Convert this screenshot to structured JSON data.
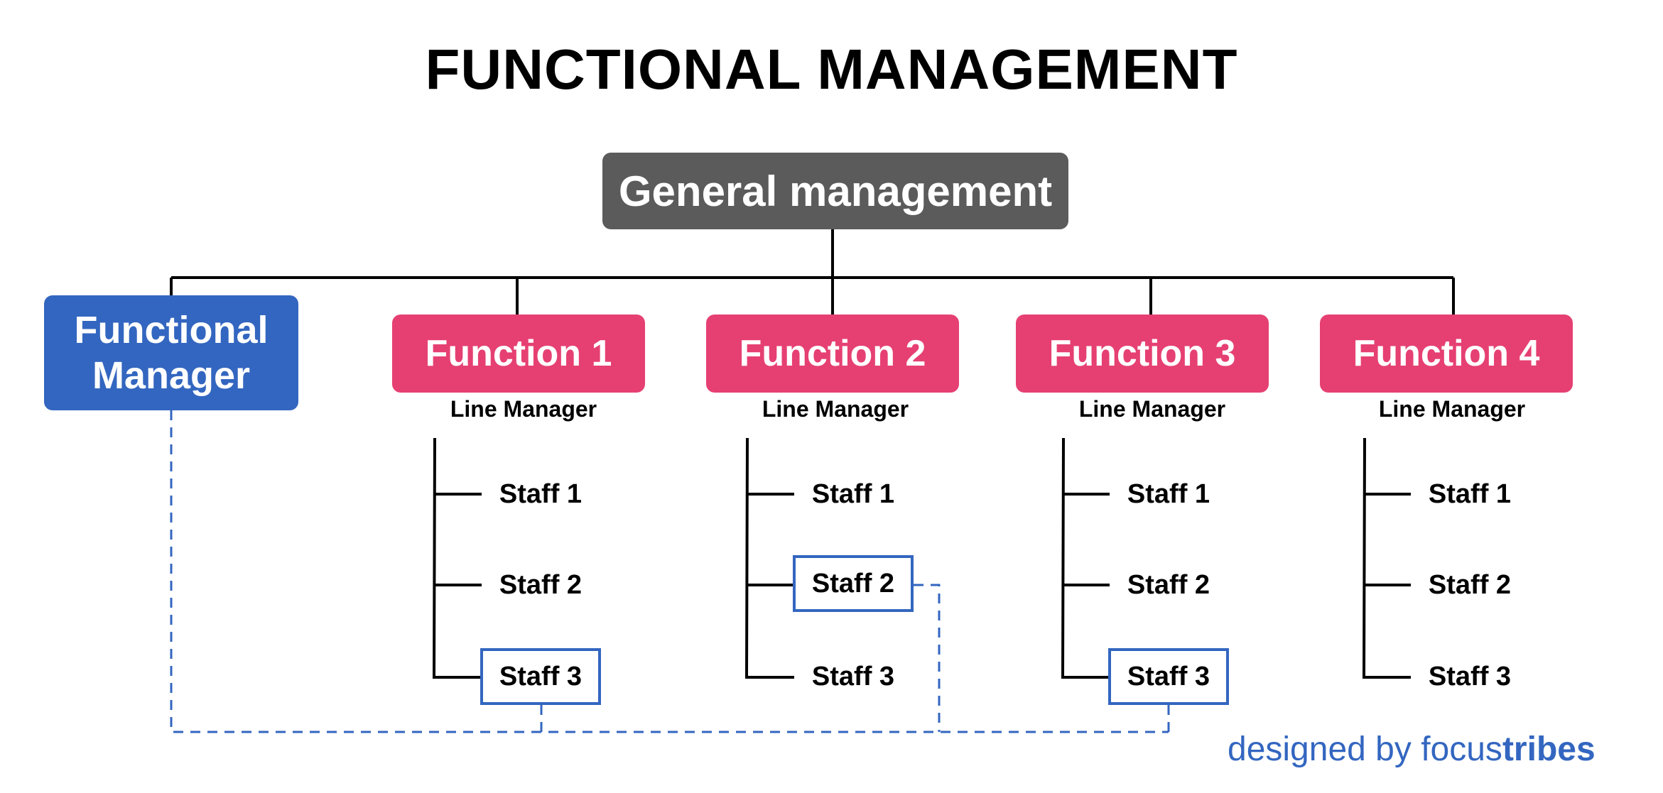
{
  "title": "FUNCTIONAL MANAGEMENT",
  "general_management": {
    "label": "General management"
  },
  "functional_manager": {
    "line1": "Functional",
    "line2": "Manager"
  },
  "functions": [
    {
      "label": "Function 1",
      "manager": "Line Manager",
      "staff": [
        "Staff 1",
        "Staff 2",
        "Staff 3"
      ],
      "highlighted_staff": "Staff 3"
    },
    {
      "label": "Function 2",
      "manager": "Line Manager",
      "staff": [
        "Staff 1",
        "Staff 2",
        "Staff 3"
      ],
      "highlighted_staff": "Staff 2"
    },
    {
      "label": "Function 3",
      "manager": "Line Manager",
      "staff": [
        "Staff 1",
        "Staff 2",
        "Staff 3"
      ],
      "highlighted_staff": "Staff 3"
    },
    {
      "label": "Function 4",
      "manager": "Line Manager",
      "staff": [
        "Staff 1",
        "Staff 2",
        "Staff 3"
      ],
      "highlighted_staff": null
    }
  ],
  "credit": {
    "prefix": "designed by ",
    "brand_light": "focus",
    "brand_bold": "tribes"
  },
  "colors": {
    "general_management": "#5b5b5b",
    "functional_manager": "#3366c0",
    "function": "#e64073",
    "highlight_border": "#3366c0",
    "dashed_link": "#3366c0",
    "solid_line": "#000000"
  }
}
